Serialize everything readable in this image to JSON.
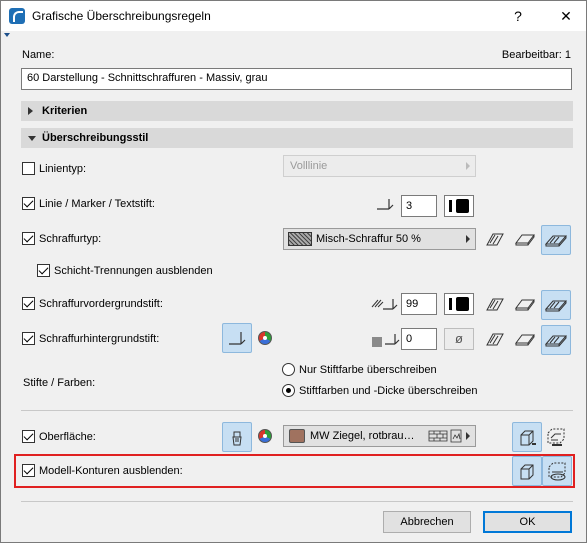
{
  "window": {
    "title": "Grafische Überschreibungsregeln",
    "help_glyph": "?",
    "close_glyph": "✕"
  },
  "header": {
    "name_label": "Name:",
    "editable_label": "Bearbeitbar: 1",
    "name_value": "60 Darstellung - Schnittschraffuren - Massiv, grau"
  },
  "sections": {
    "criteria": "Kriterien",
    "style": "Überschreibungsstil"
  },
  "rows": {
    "linetype": {
      "label": "Linientyp:",
      "checked": false,
      "popup": "Volllinie"
    },
    "line_pen": {
      "label": "Linie / Marker / Textstift:",
      "checked": true,
      "pen": "3"
    },
    "fill_type": {
      "label": "Schraffurtyp:",
      "checked": true,
      "popup": "Misch-Schraffur 50 %"
    },
    "hide_layers": {
      "label": "Schicht-Trennungen ausblenden",
      "checked": true
    },
    "fg_pen": {
      "label": "Schraffurvordergrundstift:",
      "checked": true,
      "pen": "99"
    },
    "bg_pen": {
      "label": "Schraffurhintergrundstift:",
      "checked": true,
      "pen": "0",
      "empty_symbol": "ø"
    },
    "pens_colors": {
      "label": "Stifte / Farben:",
      "option1": "Nur Stiftfarbe überschreiben",
      "option2": "Stiftfarben und -Dicke überschreiben",
      "selected": 2
    },
    "surface": {
      "label": "Oberfläche:",
      "checked": true,
      "popup": "MW Ziegel, rotbrau…",
      "swatch_color": "#a0725f"
    },
    "hide_contours": {
      "label": "Modell-Konturen ausblenden:",
      "checked": true
    }
  },
  "footer": {
    "cancel": "Abbrechen",
    "ok": "OK"
  },
  "colors": {
    "highlight": "#e02020",
    "active_button": "#c7dff3",
    "section_bg": "#d9d9d9"
  }
}
